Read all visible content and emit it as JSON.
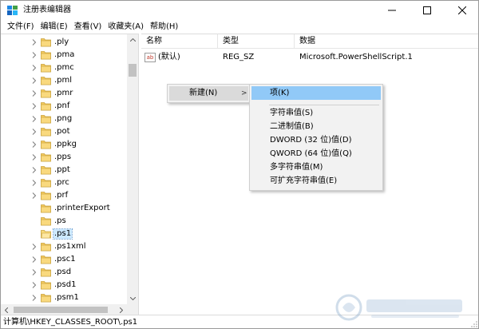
{
  "window": {
    "title": "注册表编辑器",
    "controls": [
      "minimize",
      "maximize",
      "close"
    ]
  },
  "menu": [
    "文件(F)",
    "编辑(E)",
    "查看(V)",
    "收藏夹(A)",
    "帮助(H)"
  ],
  "tree": {
    "items": [
      {
        "label": ".ply",
        "expandable": true
      },
      {
        "label": ".pma",
        "expandable": true
      },
      {
        "label": ".pmc",
        "expandable": true
      },
      {
        "label": ".pml",
        "expandable": true
      },
      {
        "label": ".pmr",
        "expandable": true
      },
      {
        "label": ".pnf",
        "expandable": true
      },
      {
        "label": ".png",
        "expandable": true
      },
      {
        "label": ".pot",
        "expandable": true
      },
      {
        "label": ".ppkg",
        "expandable": true
      },
      {
        "label": ".pps",
        "expandable": true
      },
      {
        "label": ".ppt",
        "expandable": true
      },
      {
        "label": ".prc",
        "expandable": true
      },
      {
        "label": ".prf",
        "expandable": true
      },
      {
        "label": ".printerExport",
        "expandable": false
      },
      {
        "label": ".ps",
        "expandable": false
      },
      {
        "label": ".ps1",
        "expandable": false,
        "selected": true
      },
      {
        "label": ".ps1xml",
        "expandable": true
      },
      {
        "label": ".psc1",
        "expandable": true
      },
      {
        "label": ".psd",
        "expandable": true
      },
      {
        "label": ".psd1",
        "expandable": true
      },
      {
        "label": ".psm1",
        "expandable": true
      }
    ]
  },
  "list": {
    "columns": [
      "名称",
      "类型",
      "数据"
    ],
    "rows": [
      {
        "name": "(默认)",
        "type": "REG_SZ",
        "data": "Microsoft.PowerShellScript.1",
        "icon": "ab"
      }
    ]
  },
  "context_menu": {
    "parent_label": "新建(N)",
    "parent_arrow": ">",
    "submenu": [
      "项(K)",
      "字符串值(S)",
      "二进制值(B)",
      "DWORD (32 位)值(D)",
      "QWORD (64 位)值(Q)",
      "多字符串值(M)",
      "可扩充字符串值(E)"
    ],
    "highlight_index": 0
  },
  "status": {
    "path": "计算机\\HKEY_CLASSES_ROOT\\.ps1"
  },
  "colors": {
    "selection": "#cce8ff",
    "menu_highlight": "#91c9f7",
    "menu_bg": "#f2f2f2",
    "folder": "#f4c95d"
  }
}
